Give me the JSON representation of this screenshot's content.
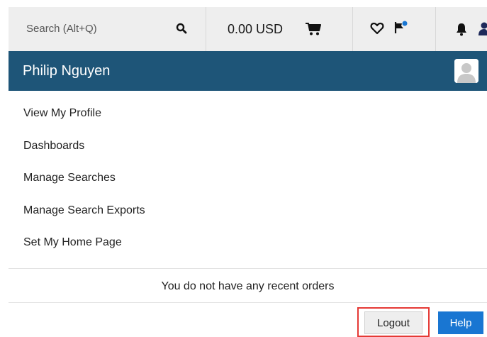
{
  "topbar": {
    "search_placeholder": "Search (Alt+Q)",
    "cart_amount": "0.00 USD"
  },
  "icons": {
    "search": "search-icon",
    "cart": "cart-icon",
    "favorites": "heart-icon",
    "flag": "flag-icon",
    "notifications": "bell-icon",
    "user": "user-icon",
    "avatar": "avatar-placeholder"
  },
  "colors": {
    "header_bg": "#1e5578",
    "topbar_bg": "#eeeeee",
    "help_button": "#1976d2",
    "highlight_border": "#e53935",
    "flag_dot": "#1976d2"
  },
  "profile": {
    "name": "Philip Nguyen"
  },
  "menu": {
    "items": [
      {
        "label": "View My Profile"
      },
      {
        "label": "Dashboards"
      },
      {
        "label": "Manage Searches"
      },
      {
        "label": "Manage Search Exports"
      },
      {
        "label": "Set My Home Page"
      }
    ]
  },
  "orders": {
    "empty_message": "You do not have any recent orders"
  },
  "actions": {
    "logout_label": "Logout",
    "help_label": "Help"
  }
}
